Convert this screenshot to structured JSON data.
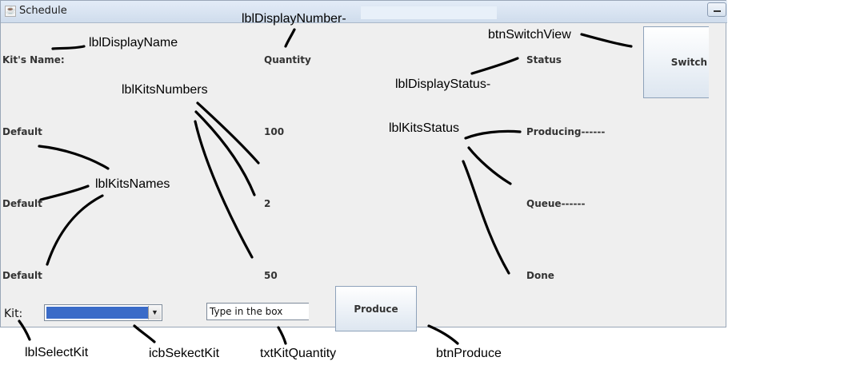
{
  "window": {
    "title": "Schedule"
  },
  "headers": {
    "name": "Kit's Name:",
    "quantity": "Quantity",
    "status": "Status"
  },
  "rows": [
    {
      "name": "Default",
      "quantity": "100",
      "status": "Producing------"
    },
    {
      "name": "Default",
      "quantity": "2",
      "status": "Queue------"
    },
    {
      "name": "Default",
      "quantity": "50",
      "status": "Done"
    }
  ],
  "controls": {
    "kit_label": "Kit:",
    "kit_combo_value": "",
    "quantity_placeholder": "Type in the box",
    "quantity_value": "Type in the box",
    "produce_button": "Produce",
    "switch_button": "Switch"
  },
  "annotations": {
    "display_name": "lblDisplayName",
    "display_number": "lblDisplayNumber-",
    "switch_view": "btnSwitchView",
    "display_status": "lblDisplayStatus-",
    "kits_numbers": "lblKitsNumbers",
    "kits_status": "lblKitsStatus",
    "kits_names": "lblKitsNames",
    "select_kit": "lblSelectKit",
    "combo_select_kit": "icbSekectKit",
    "txt_kit_quantity": "txtKitQuantity",
    "btn_produce": "btnProduce"
  },
  "colors": {
    "window_bg": "#efefef",
    "combo_selection": "#3a6bc8",
    "button_gradient_bottom": "#dde6f0"
  }
}
